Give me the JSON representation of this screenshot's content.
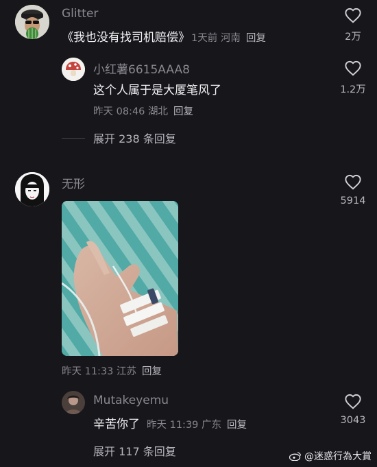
{
  "comments": [
    {
      "username": "Glitter",
      "text": "《我也没有找司机赔偿》",
      "time": "1天前",
      "location": "河南",
      "reply_label": "回复",
      "likes": "2万",
      "avatar_icon": "cactus-avatar-icon"
    },
    {
      "username": "小红薯6615AAA8",
      "text": "这个人属于是大厦笔风了",
      "time": "昨天 08:46",
      "location": "湖北",
      "reply_label": "回复",
      "likes": "1.2万",
      "avatar_icon": "mushroom-avatar-icon"
    },
    {
      "username": "无形",
      "text": "",
      "time": "昨天 11:33",
      "location": "江苏",
      "reply_label": "回复",
      "likes": "5914",
      "avatar_icon": "anime-girl-avatar-icon",
      "image": "hospital-iv-hand-photo"
    },
    {
      "username": "Mutakeyemu",
      "text": "辛苦你了",
      "time": "昨天 11:39",
      "location": "广东",
      "reply_label": "回复",
      "likes": "3043",
      "avatar_icon": "person-avatar-icon"
    }
  ],
  "expand_replies": [
    {
      "label": "展开 238 条回复"
    },
    {
      "label": "展开 117 条回复"
    }
  ],
  "watermark": "@迷惑行為大賞",
  "colors": {
    "background": "#17161b",
    "name": "#8a8990",
    "body": "#f2f2f4",
    "meta": "#88878e",
    "accent_text": "#b9b8bf"
  }
}
